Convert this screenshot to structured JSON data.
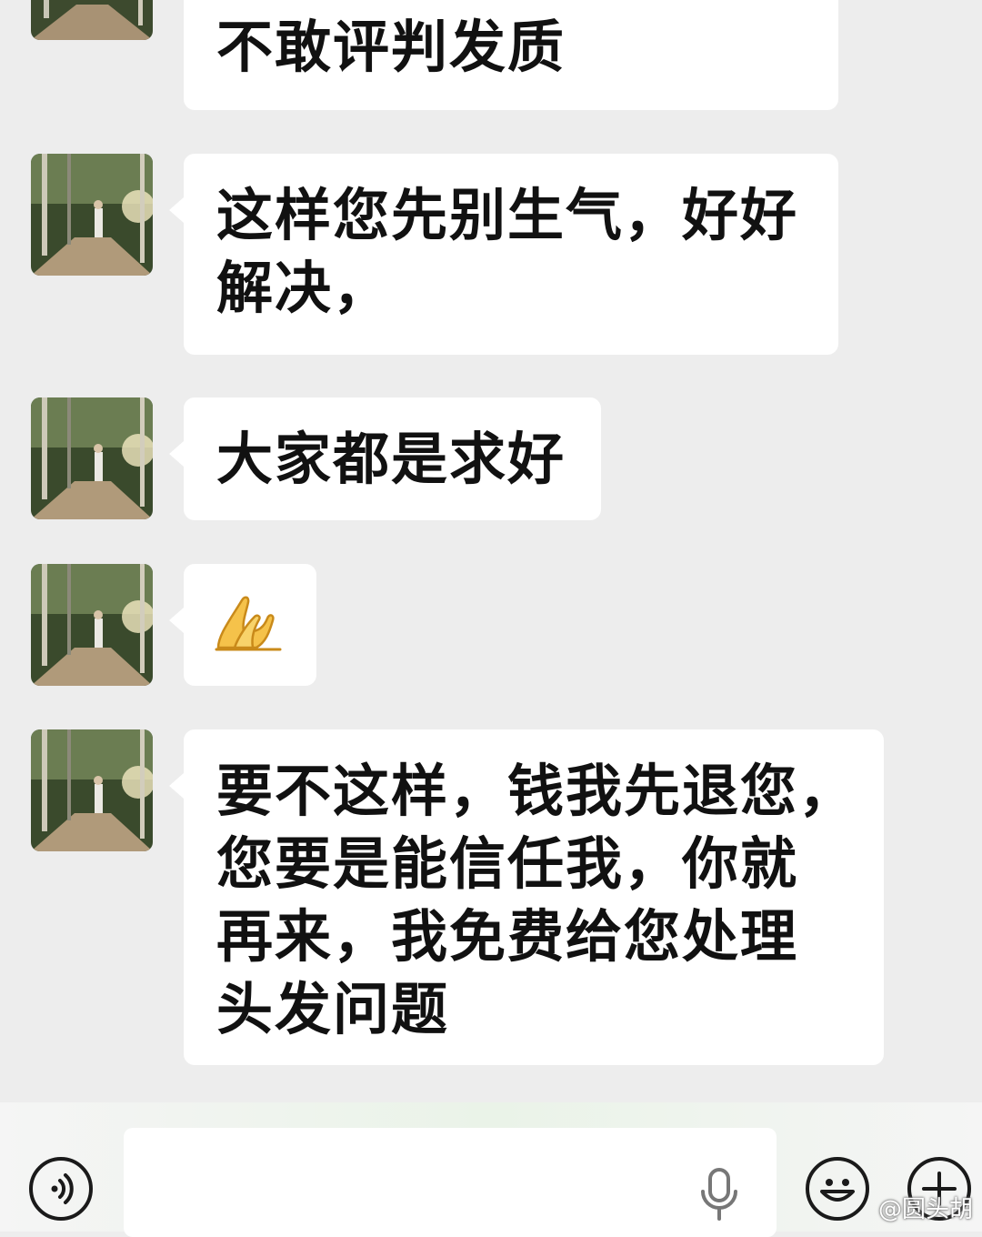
{
  "messages": [
    {
      "id": "m1",
      "lines": [
        "不敢评判发质"
      ]
    },
    {
      "id": "m2",
      "lines": [
        "这样您先别生气，好好",
        "解决，"
      ]
    },
    {
      "id": "m3",
      "lines": [
        "大家都是求好"
      ]
    },
    {
      "id": "m4",
      "emoji": "folded-hands-emoji"
    },
    {
      "id": "m5",
      "lines": [
        "要不这样，钱我先退您，",
        "您要是能信任我，你就",
        "再来，我免费给您处理",
        "头发问题"
      ]
    }
  ],
  "input_bar": {
    "voice_icon": "voice-toggle-icon",
    "text_value": "",
    "mic_icon": "microphone-icon",
    "emoji_icon": "smiley-icon",
    "plus_icon": "plus-icon"
  },
  "watermark": "@圆头胡",
  "colors": {
    "background": "#ededed",
    "bubble": "#ffffff",
    "text": "#111111"
  }
}
